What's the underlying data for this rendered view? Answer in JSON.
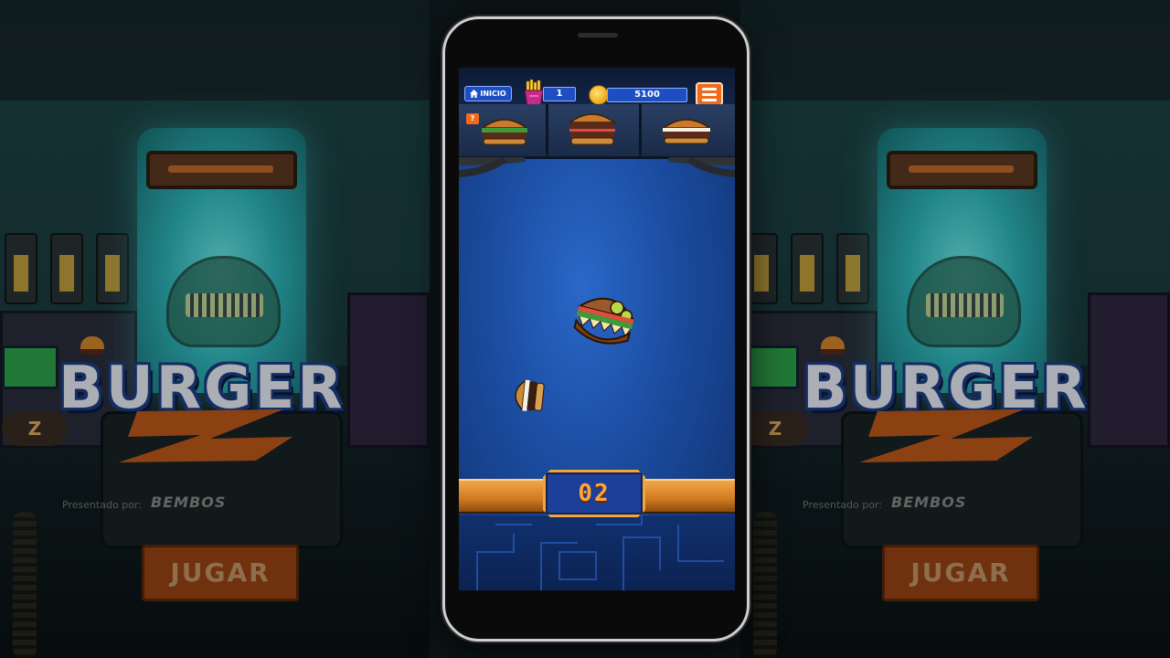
{
  "background": {
    "title": "BURGER",
    "sponsor_label": "Presentado por:",
    "sponsor_brand": "BEMBOS",
    "play_button": "JUGAR",
    "badge": "Z"
  },
  "hud": {
    "home_label": "INICIO",
    "fries_count": "1",
    "coins": "5100",
    "help_label": "?"
  },
  "orders": [
    {
      "name": "classic-burger-icon"
    },
    {
      "name": "double-burger-icon"
    },
    {
      "name": "cheese-burger-icon"
    }
  ],
  "game": {
    "counter": "02"
  },
  "colors": {
    "accent_orange": "#ef6a1a",
    "hud_blue": "#1e4fc2",
    "screen_blue": "#1a4b9e",
    "counter_text": "#ffa43a"
  }
}
